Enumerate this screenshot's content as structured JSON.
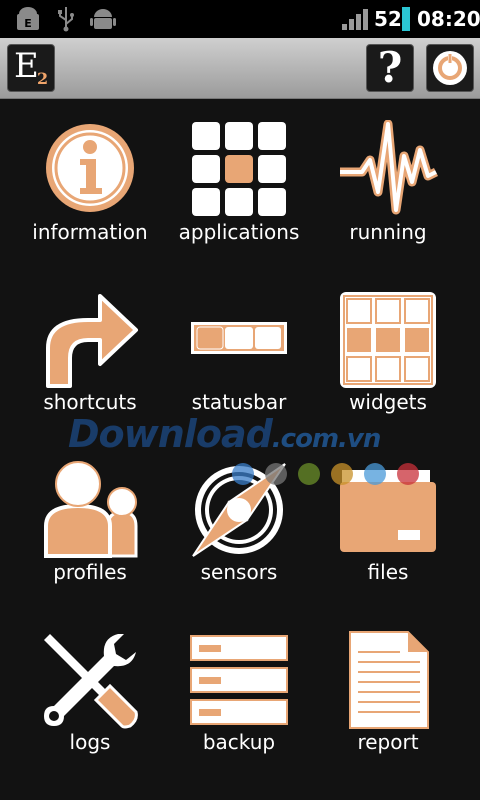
{
  "status_bar": {
    "battery_level": "52",
    "time": "08:20",
    "icons": [
      "android-debug-icon",
      "usb-icon",
      "android-icon",
      "signal-icon",
      "battery-icon"
    ]
  },
  "toolbar": {
    "logo_letter": "E",
    "logo_subscript": "2",
    "help_label": "?",
    "icons": [
      "app-logo-icon",
      "help-icon",
      "power-icon"
    ]
  },
  "menu": {
    "items": [
      {
        "label": "information",
        "icon": "information-icon"
      },
      {
        "label": "applications",
        "icon": "applications-grid-icon"
      },
      {
        "label": "running",
        "icon": "activity-wave-icon"
      },
      {
        "label": "shortcuts",
        "icon": "arrow-shortcut-icon"
      },
      {
        "label": "statusbar",
        "icon": "statusbar-icon"
      },
      {
        "label": "widgets",
        "icon": "widgets-grid-icon"
      },
      {
        "label": "profiles",
        "icon": "profiles-people-icon"
      },
      {
        "label": "sensors",
        "icon": "compass-icon"
      },
      {
        "label": "files",
        "icon": "folder-icon"
      },
      {
        "label": "logs",
        "icon": "tools-icon"
      },
      {
        "label": "backup",
        "icon": "backup-stack-icon"
      },
      {
        "label": "report",
        "icon": "document-icon"
      }
    ]
  },
  "watermark": {
    "text": "Download",
    "suffix": ".com.vn"
  },
  "colors": {
    "accent": "#e8a675",
    "icon_fill": "#ffffff",
    "background": "#121212"
  }
}
